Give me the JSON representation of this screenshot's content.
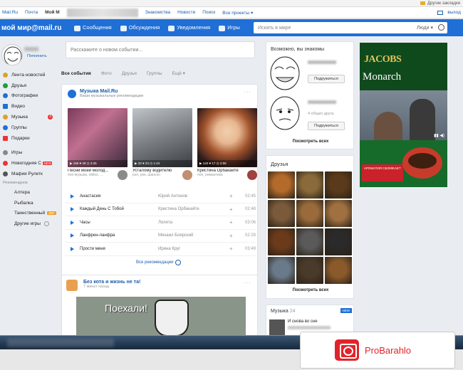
{
  "bookmarks_bar": {
    "other_bookmarks": "Другие закладки"
  },
  "portal": {
    "links": [
      "Mail.Ru",
      "Почта",
      "Мой М"
    ],
    "links2": [
      "Знакомства",
      "Новости",
      "Поиск",
      "Все проекты ▾"
    ],
    "logout": "выход"
  },
  "header": {
    "logo": "мой мир@mail.ru",
    "nav": [
      "Сообщения",
      "Обсуждения",
      "Уведомления",
      "Игры"
    ],
    "search_placeholder": "Искать в мире",
    "search_scope": "Люди ▾"
  },
  "sidebar": {
    "replenish": "Пополнить",
    "items": [
      {
        "label": "Лента новостей",
        "color": "#e0a030"
      },
      {
        "label": "Друзья",
        "color": "#1f9d3a"
      },
      {
        "label": "Фотографии",
        "color": "#1f6fd6"
      },
      {
        "label": "Видео",
        "color": "#1f6fd6"
      },
      {
        "label": "Музыка",
        "color": "#e0a030",
        "badge": "3"
      },
      {
        "label": "Группы",
        "color": "#1f6fd6"
      },
      {
        "label": "Подарки",
        "color": "#e33"
      }
    ],
    "items2": [
      {
        "label": "Игры",
        "color": "#888"
      },
      {
        "label": "Новогодняя С",
        "color": "#e33",
        "new": "NEW"
      },
      {
        "label": "Мафия Рулетк",
        "color": "#555"
      }
    ],
    "recommended": "Рекомендуем",
    "games": [
      "Алтера",
      "Рыбалка",
      "Таинственный",
      "Другие игры"
    ],
    "game_tag": "ЛИГ"
  },
  "feed": {
    "compose_placeholder": "Расскажите о новом событии...",
    "tabs": [
      "Все события",
      "Фото",
      "Друзья",
      "Группы",
      "Ещё ▾"
    ]
  },
  "music_card": {
    "title": "Музыка Mail.Ru",
    "subtitle": "Ваши музыкальные рекомендации",
    "dots": "···",
    "covers": [
      {
        "name": "Песни моей молод...",
        "genre": "поп-музыка, oldies, ...",
        "stat": "▶ 185   ♥ 49   ◷ 3:26"
      },
      {
        "name": "Усталому водителю",
        "genre": "рэп, рок, шансон",
        "stat": "▶ 33   ♥ 23   ◷ 1:43"
      },
      {
        "name": "Кристина Орбакайте",
        "genre": "поп, романтика",
        "stat": "▶ 120   ♥ 17   ◷ 2:58"
      }
    ],
    "tracks": [
      {
        "title": "Анастасия",
        "artist": "Юрий Антонов",
        "dur": "02:45"
      },
      {
        "title": "Каждый День С Тобой",
        "artist": "Кристина Орбакайте",
        "dur": "02:48"
      },
      {
        "title": "Часы",
        "artist": "Лолита",
        "dur": "03:06"
      },
      {
        "title": "Ланфрен-ланфра",
        "artist": "Михаил Боярский",
        "dur": "02:29"
      },
      {
        "title": "Прости меня",
        "artist": "Ирина Круг",
        "dur": "03:49"
      }
    ],
    "all_recs": "Все рекомендации"
  },
  "post": {
    "title": "Без кота и жизнь не та!",
    "date": "7 минут назад",
    "dots": "···",
    "photo_text": "Поехали!"
  },
  "possible_friends": {
    "title": "Возможно, вы знакомы",
    "common_friends": "4 общих друга",
    "add_label": "Подружиться",
    "see_all": "Посмотреть всех"
  },
  "friends": {
    "title": "Друзья",
    "see_all": "Посмотреть всех",
    "tiles": [
      "#b36a2a",
      "#8a6a3a",
      "#5a3a1a",
      "#7a5a3a",
      "#9a6a3a",
      "#a07040",
      "#6a3a1a",
      "#5a5a5a",
      "#2a2a2a",
      "#6a7a8a",
      "#4a3a2a",
      "#8a5a2a"
    ]
  },
  "music_widget": {
    "title": "Музыка",
    "count": "24",
    "new": "NEW",
    "track": "И снова во сне"
  },
  "ad": {
    "brand1": "JACOBS",
    "brand2": "Monarch",
    "slogan": "АРОМАТИЯ СБЛИЖАЕТ",
    "video_icon": "▮▮ ◀)"
  },
  "watermark": {
    "text": "ProBarahlo"
  }
}
